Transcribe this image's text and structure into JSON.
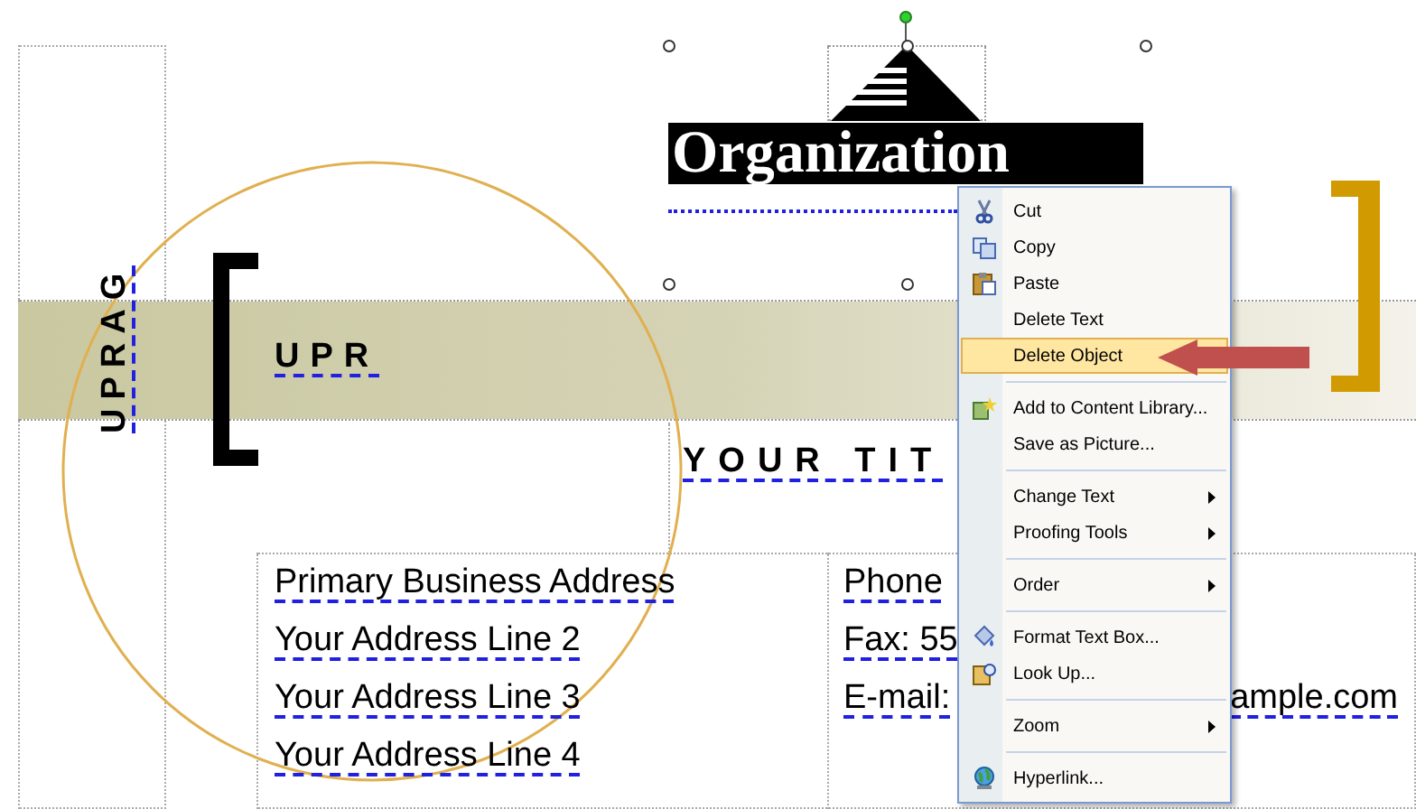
{
  "logo": {
    "name": "Organization"
  },
  "band": {
    "vertical_text": "UPRAG",
    "text": "UPR"
  },
  "title": {
    "text": "YOUR TIT"
  },
  "address_lines": [
    "Primary Business Address",
    "Your Address Line 2",
    "Your Address Line 3",
    "Your Address Line 4"
  ],
  "contact_lines": [
    {
      "left": "Phone"
    },
    {
      "left": "Fax: 55"
    },
    {
      "left": "E-mail:",
      "right": "ample.com"
    }
  ],
  "context_menu": {
    "items": [
      {
        "kind": "item",
        "label": "Cut",
        "selected": false,
        "submenu": false
      },
      {
        "kind": "item",
        "label": "Copy",
        "selected": false,
        "submenu": false
      },
      {
        "kind": "item",
        "label": "Paste",
        "selected": false,
        "submenu": false
      },
      {
        "kind": "item",
        "label": "Delete Text",
        "selected": false,
        "submenu": false
      },
      {
        "kind": "item",
        "label": "Delete Object",
        "selected": true,
        "submenu": false
      },
      {
        "kind": "separator"
      },
      {
        "kind": "item",
        "label": "Add to Content Library...",
        "selected": false,
        "submenu": false
      },
      {
        "kind": "item",
        "label": "Save as Picture...",
        "selected": false,
        "submenu": false
      },
      {
        "kind": "separator"
      },
      {
        "kind": "item",
        "label": "Change Text",
        "selected": false,
        "submenu": true
      },
      {
        "kind": "item",
        "label": "Proofing Tools",
        "selected": false,
        "submenu": true
      },
      {
        "kind": "separator"
      },
      {
        "kind": "item",
        "label": "Order",
        "selected": false,
        "submenu": true
      },
      {
        "kind": "separator"
      },
      {
        "kind": "item",
        "label": "Format Text Box...",
        "selected": false,
        "submenu": false
      },
      {
        "kind": "item",
        "label": "Look Up...",
        "selected": false,
        "submenu": false
      },
      {
        "kind": "separator"
      },
      {
        "kind": "item",
        "label": "Zoom",
        "selected": false,
        "submenu": true
      },
      {
        "kind": "separator"
      },
      {
        "kind": "item",
        "label": "Hyperlink...",
        "selected": false,
        "submenu": false
      }
    ]
  }
}
